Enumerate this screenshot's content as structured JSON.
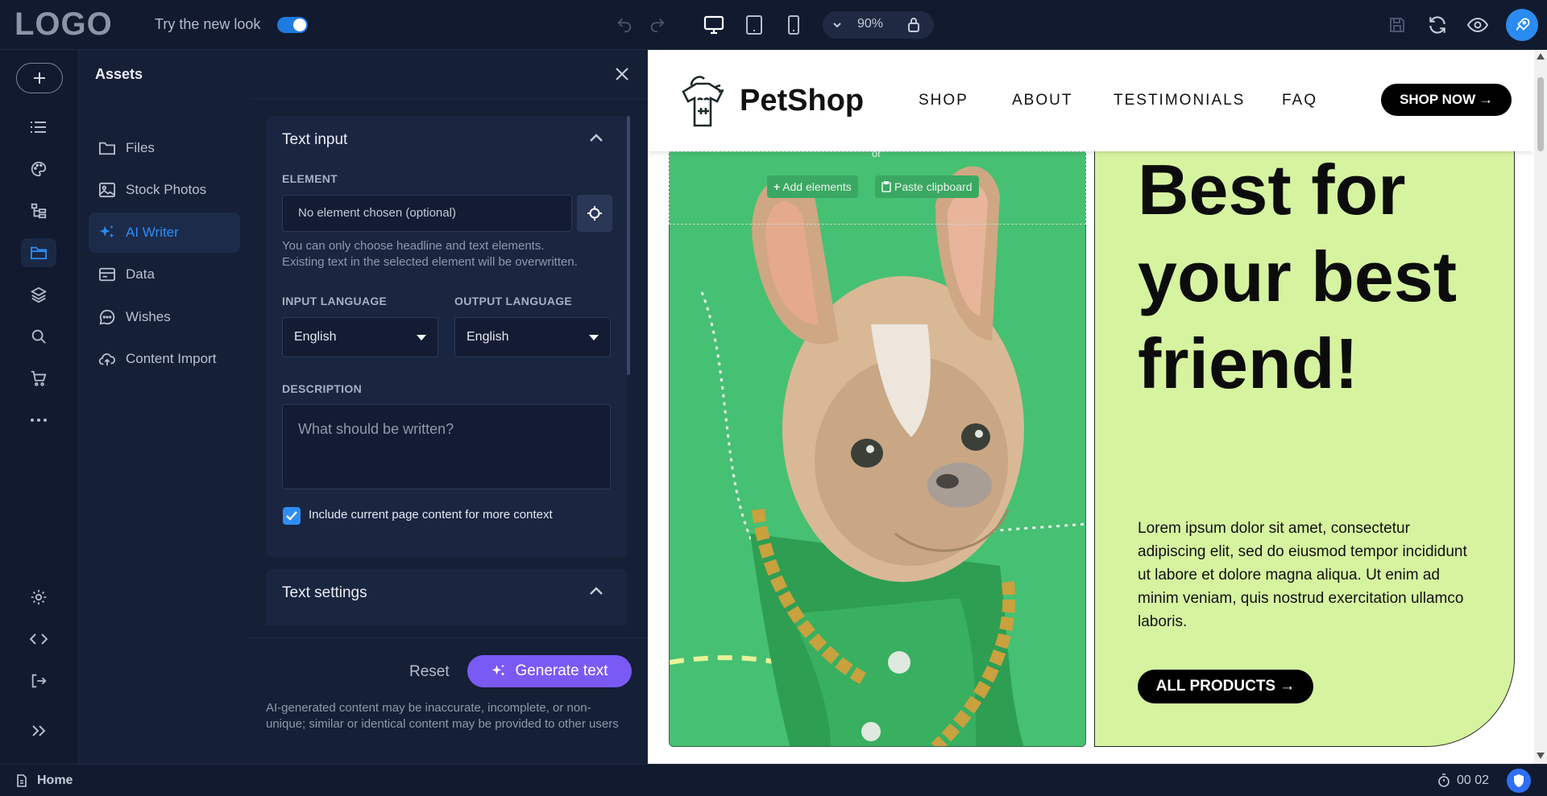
{
  "topbar": {
    "logo": "LOGO",
    "try_new_look": "Try the new look",
    "zoom": "90%"
  },
  "rail": {
    "icons": [
      "plus-icon",
      "list-icon",
      "palette-icon",
      "sitemap-icon",
      "folder-icon",
      "layers-icon",
      "search-icon",
      "cart-icon",
      "more-icon",
      "gear-icon",
      "code-icon",
      "exit-icon",
      "expand-icon"
    ]
  },
  "assets": {
    "title": "Assets",
    "items": [
      {
        "label": "Files"
      },
      {
        "label": "Stock Photos"
      },
      {
        "label": "AI Writer"
      },
      {
        "label": "Data"
      },
      {
        "label": "Wishes"
      },
      {
        "label": "Content Import"
      }
    ]
  },
  "ai_writer": {
    "text_input_title": "Text input",
    "element_label": "ELEMENT",
    "element_placeholder": "No element chosen (optional)",
    "element_help_1": "You can only choose headline and text elements.",
    "element_help_2": "Existing text in the selected element will be overwritten.",
    "input_language_label": "INPUT LANGUAGE",
    "input_language_value": "English",
    "output_language_label": "OUTPUT LANGUAGE",
    "output_language_value": "English",
    "description_label": "DESCRIPTION",
    "description_placeholder": "What should be written?",
    "include_context_label": "Include current page content for more context",
    "text_settings_title": "Text settings",
    "reset_label": "Reset",
    "generate_label": "Generate text",
    "disclaimer": "AI-generated content may be inaccurate, incomplete, or non-unique; similar or identical content may be provided to other users"
  },
  "site": {
    "brand": "PetShop",
    "nav": [
      "SHOP",
      "ABOUT",
      "TESTIMONIALS",
      "FAQ"
    ],
    "shop_now": "SHOP NOW →",
    "dropzone_or": "or",
    "add_elements": "Add elements",
    "paste_clipboard": "Paste clipboard",
    "headline": "Best for your best friend!",
    "lorem": "Lorem ipsum dolor sit amet, consectetur adipiscing elit, sed do eiusmod tempor incididunt ut labore et dolore magna aliqua. Ut enim ad minim veniam, quis nostrud exercitation ullamco laboris.",
    "all_products": "ALL PRODUCTS →"
  },
  "status": {
    "home": "Home",
    "timer": "00 02"
  },
  "colors": {
    "accent_blue": "#2e8df5",
    "generate_purple": "#7a5af5",
    "lime": "#d6f3a0",
    "dog_green": "#46c072"
  }
}
